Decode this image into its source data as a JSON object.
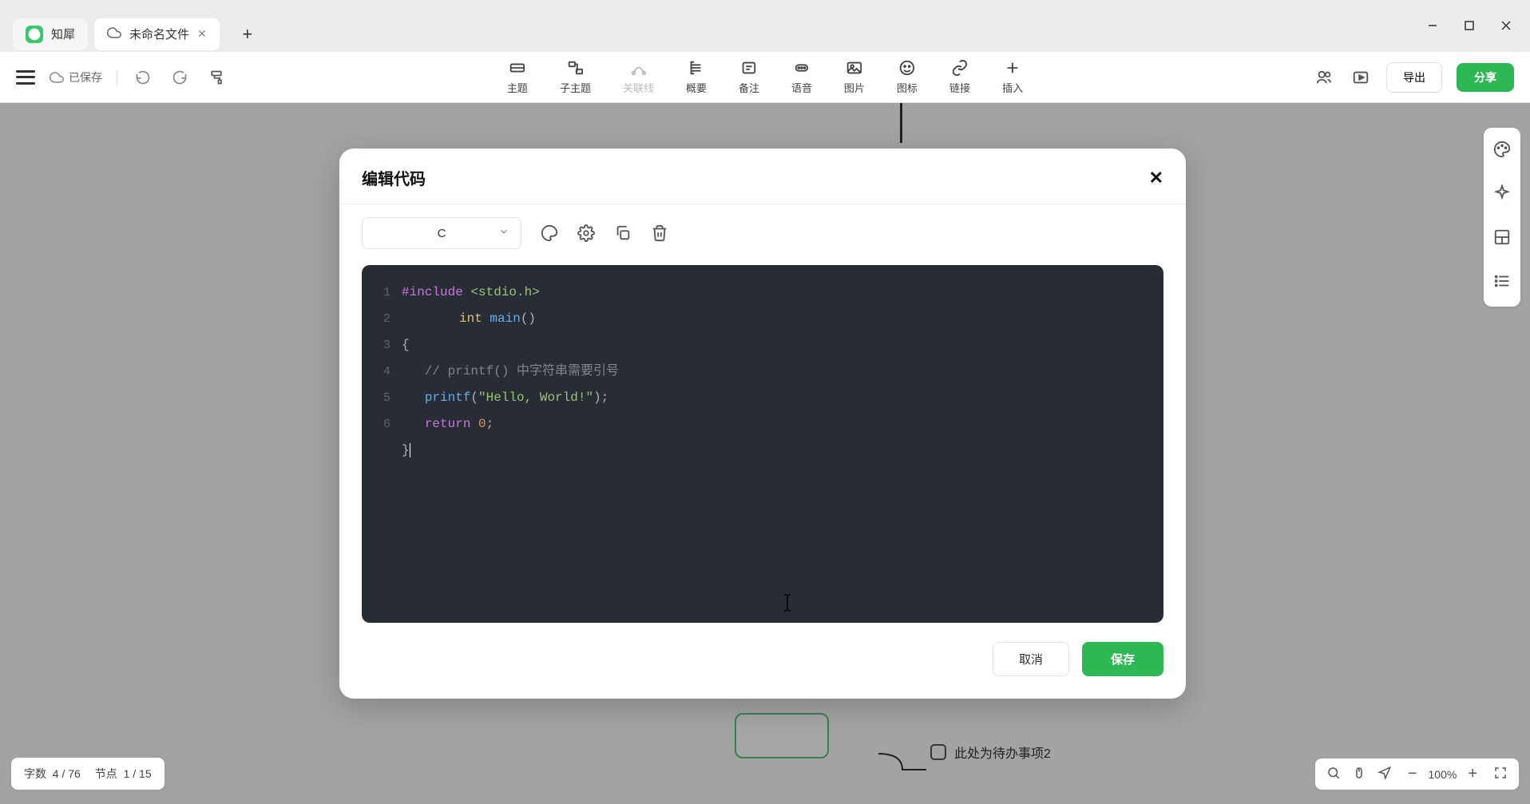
{
  "titlebar": {
    "home_tab": "知犀",
    "doc_tab": "未命名文件"
  },
  "toolbar": {
    "save_status": "已保存",
    "items": {
      "theme": "主题",
      "subtopic": "子主题",
      "relation": "关联线",
      "summary": "概要",
      "note": "备注",
      "audio": "语音",
      "image": "图片",
      "icon": "图标",
      "link": "链接",
      "insert": "插入"
    },
    "export": "导出",
    "share": "分享"
  },
  "modal": {
    "title": "编辑代码",
    "language": "C",
    "cancel": "取消",
    "save": "保存",
    "code": {
      "line1_a": "#include",
      "line1_b": "<stdio.h>",
      "line1_c_type": "int",
      "line1_c_fn": "main",
      "line1_c_paren": "()",
      "line2": "{",
      "line3_cmt": "// printf() 中字符串需要引号",
      "line4_fn": "printf",
      "line4_paren_open": "(",
      "line4_str": "\"Hello, World!\"",
      "line4_end": ");",
      "line5_kw": "return",
      "line5_num": "0",
      "line5_end": ";",
      "line6": "}"
    },
    "line_numbers": [
      "1",
      "",
      "2",
      "3",
      "4",
      "5",
      "6"
    ]
  },
  "statusbar": {
    "word_label": "字数",
    "word_value": "4 / 76",
    "node_label": "节点",
    "node_value": "1 / 15",
    "zoom": "100%"
  },
  "background": {
    "todo_item": "此处为待办事项2"
  }
}
